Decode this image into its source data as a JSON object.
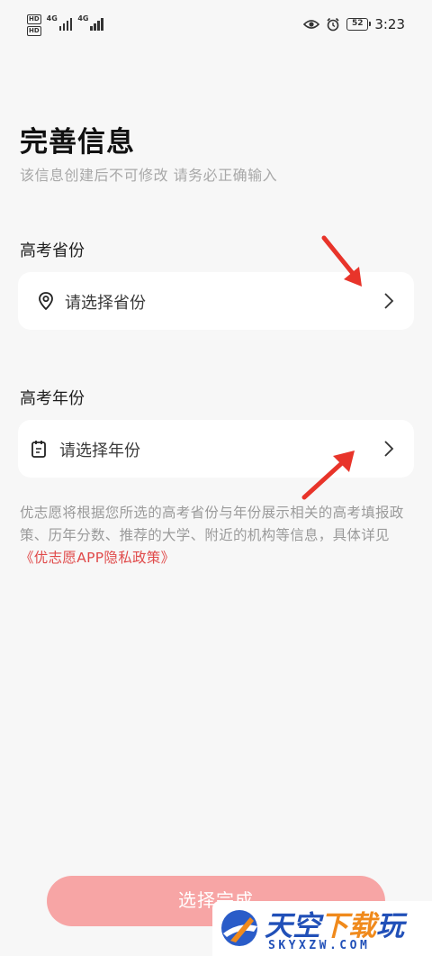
{
  "status_bar": {
    "hd_label": "HD",
    "network_1": "4G",
    "network_2": "4G",
    "battery": "52",
    "time": "3:23"
  },
  "header": {
    "title": "完善信息",
    "subtitle": "该信息创建后不可修改  请务必正确输入"
  },
  "province": {
    "label": "高考省份",
    "placeholder": "请选择省份",
    "icon": "location-pin-icon"
  },
  "year": {
    "label": "高考年份",
    "placeholder": "请选择年份",
    "icon": "calendar-icon"
  },
  "notice": {
    "text": "优志愿将根据您所选的高考省份与年份展示相关的高考填报政策、历年分数、推荐的大学、附近的机构等信息，具体详见",
    "link": "《优志愿APP隐私政策》"
  },
  "submit": {
    "label": "选择完成"
  },
  "watermark": {
    "title_blue": "天空",
    "title_orange": "下载",
    "title_blue2": "玩",
    "url": "SKYXZW.COM"
  },
  "colors": {
    "accent": "#e04a4a",
    "button": "#f7a5a5",
    "background": "#f7f7f7",
    "annotation_arrow": "#e8342a"
  }
}
